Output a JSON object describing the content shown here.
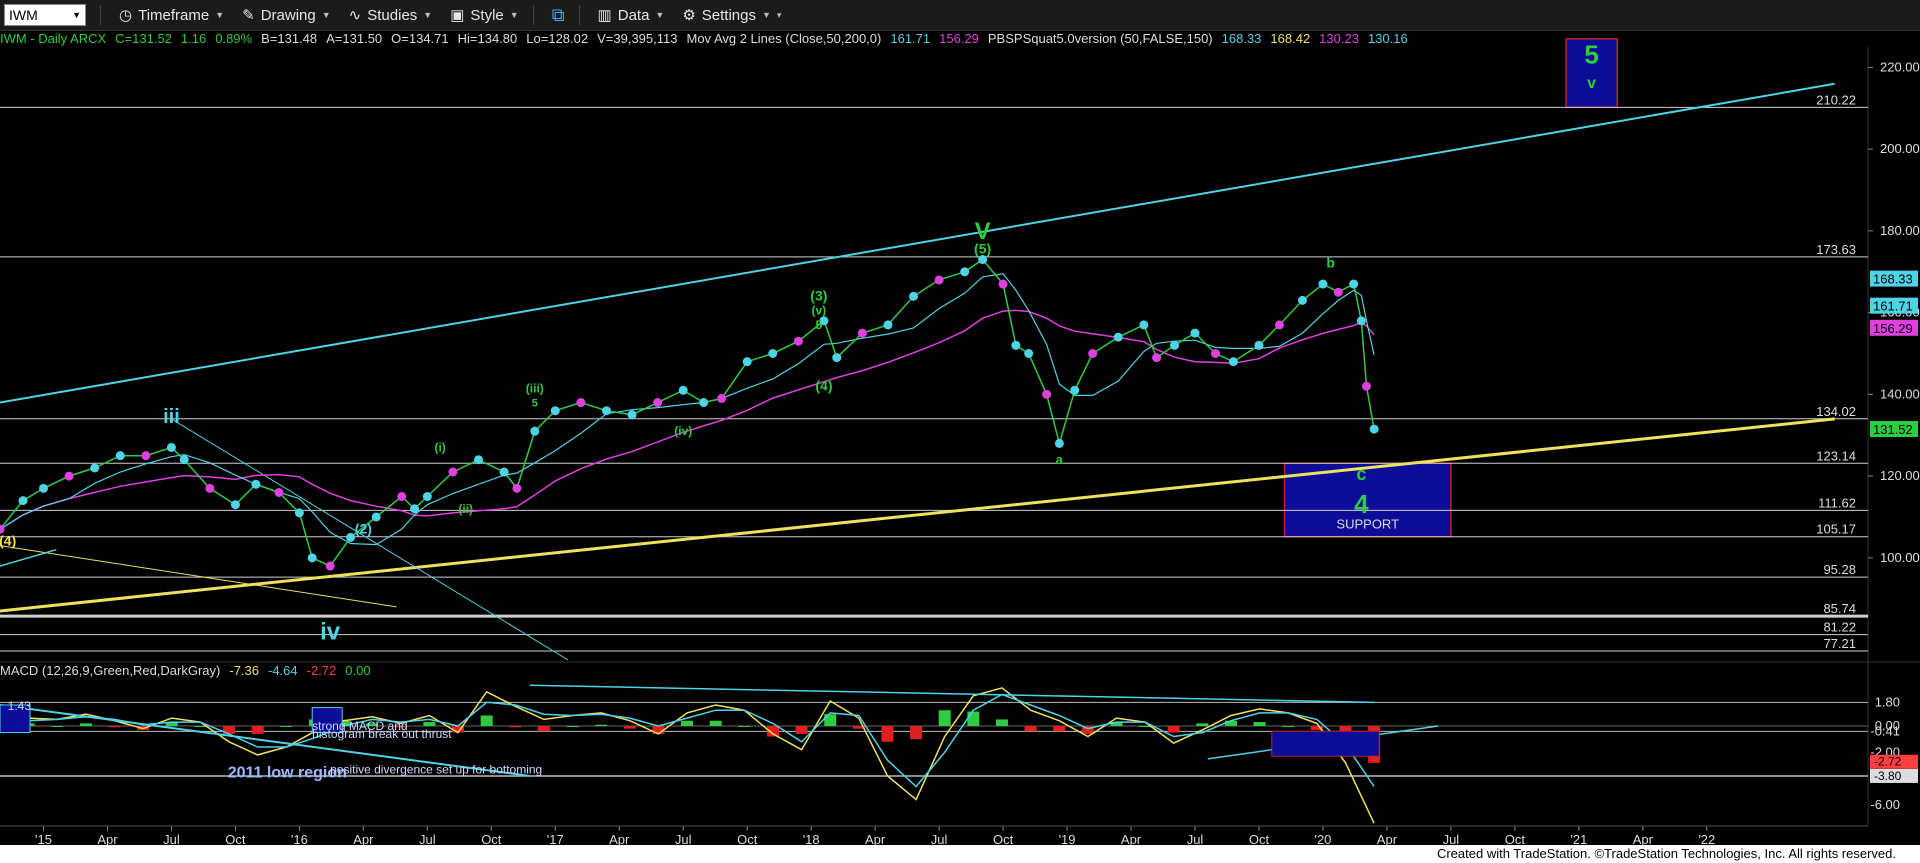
{
  "toolbar": {
    "symbol": "IWM",
    "items": [
      {
        "label": "Timeframe",
        "icon": "clock-icon"
      },
      {
        "label": "Drawing",
        "icon": "pencil-icon"
      },
      {
        "label": "Studies",
        "icon": "studies-icon"
      },
      {
        "label": "Style",
        "icon": "style-icon"
      },
      {
        "label": "",
        "icon": "layout-icon"
      },
      {
        "label": "Data",
        "icon": "data-icon"
      },
      {
        "label": "Settings",
        "icon": "gear-icon"
      }
    ]
  },
  "legend": [
    {
      "text": "IWM - Daily  ARCX",
      "color": "#2ecc40"
    },
    {
      "text": "C=131.52",
      "color": "#2ecc40"
    },
    {
      "text": "1.16",
      "color": "#2ecc40"
    },
    {
      "text": "0.89%",
      "color": "#2ecc40"
    },
    {
      "text": "B=131.48",
      "color": "#dddddd"
    },
    {
      "text": "A=131.50",
      "color": "#dddddd"
    },
    {
      "text": "O=134.71",
      "color": "#dddddd"
    },
    {
      "text": "Hi=134.80",
      "color": "#dddddd"
    },
    {
      "text": "Lo=128.02",
      "color": "#dddddd"
    },
    {
      "text": "V=39,395,113",
      "color": "#dddddd"
    },
    {
      "text": "Mov Avg 2 Lines (Close,50,200,0)",
      "color": "#dddddd"
    },
    {
      "text": "161.71",
      "color": "#4fd3e6"
    },
    {
      "text": "156.29",
      "color": "#e040e0"
    },
    {
      "text": "PBSPSquat5.0version (50,FALSE,150)",
      "color": "#dddddd"
    },
    {
      "text": "168.33",
      "color": "#4fd3e6"
    },
    {
      "text": "168.42",
      "color": "#f0e060"
    },
    {
      "text": "130.23",
      "color": "#e040e0"
    },
    {
      "text": "130.16",
      "color": "#4fd3e6"
    }
  ],
  "macd_legend": [
    {
      "text": "MACD (12,26,9,Green,Red,DarkGray)",
      "color": "#dddddd"
    },
    {
      "text": "-7.36",
      "color": "#f0e060"
    },
    {
      "text": "-4.64",
      "color": "#4fd3e6"
    },
    {
      "text": "-2.72",
      "color": "#ff4040"
    },
    {
      "text": "0.00",
      "color": "#2ecc40"
    }
  ],
  "footer": "Created with TradeStation. ©TradeStation Technologies, Inc. All rights reserved.",
  "chart_data": {
    "type": "line",
    "title": "IWM - Daily",
    "price_axis": {
      "ylim": [
        75,
        225
      ],
      "ticks": [
        100,
        120,
        140,
        160,
        180,
        200,
        220
      ]
    },
    "x_ticks": [
      "'15",
      "Apr",
      "Jul",
      "Oct",
      "'16",
      "Apr",
      "Jul",
      "Oct",
      "'17",
      "Apr",
      "Jul",
      "Oct",
      "'18",
      "Apr",
      "Jul",
      "Oct",
      "'19",
      "Apr",
      "Jul",
      "Oct",
      "'20",
      "Apr",
      "Jul",
      "Oct",
      "'21",
      "Apr",
      "'22"
    ],
    "price_series": {
      "name": "IWM",
      "color": "#2ecc40",
      "points": [
        [
          2014.83,
          107
        ],
        [
          2014.92,
          114
        ],
        [
          2015.0,
          117
        ],
        [
          2015.1,
          120
        ],
        [
          2015.2,
          122
        ],
        [
          2015.3,
          125
        ],
        [
          2015.4,
          125
        ],
        [
          2015.5,
          127
        ],
        [
          2015.55,
          124
        ],
        [
          2015.65,
          117
        ],
        [
          2015.75,
          113
        ],
        [
          2015.83,
          118
        ],
        [
          2015.92,
          116
        ],
        [
          2016.0,
          111
        ],
        [
          2016.05,
          100
        ],
        [
          2016.12,
          98
        ],
        [
          2016.2,
          105
        ],
        [
          2016.3,
          110
        ],
        [
          2016.4,
          115
        ],
        [
          2016.45,
          112
        ],
        [
          2016.5,
          115
        ],
        [
          2016.6,
          121
        ],
        [
          2016.7,
          124
        ],
        [
          2016.8,
          121
        ],
        [
          2016.85,
          117
        ],
        [
          2016.92,
          131
        ],
        [
          2017.0,
          136
        ],
        [
          2017.1,
          138
        ],
        [
          2017.2,
          136
        ],
        [
          2017.3,
          135
        ],
        [
          2017.4,
          138
        ],
        [
          2017.5,
          141
        ],
        [
          2017.58,
          138
        ],
        [
          2017.65,
          139
        ],
        [
          2017.75,
          148
        ],
        [
          2017.85,
          150
        ],
        [
          2017.95,
          153
        ],
        [
          2018.05,
          158
        ],
        [
          2018.1,
          149
        ],
        [
          2018.2,
          155
        ],
        [
          2018.3,
          157
        ],
        [
          2018.4,
          164
        ],
        [
          2018.5,
          168
        ],
        [
          2018.6,
          170
        ],
        [
          2018.67,
          173
        ],
        [
          2018.75,
          167
        ],
        [
          2018.8,
          152
        ],
        [
          2018.85,
          150
        ],
        [
          2018.92,
          140
        ],
        [
          2018.97,
          128
        ],
        [
          2019.03,
          141
        ],
        [
          2019.1,
          150
        ],
        [
          2019.2,
          154
        ],
        [
          2019.3,
          157
        ],
        [
          2019.35,
          149
        ],
        [
          2019.42,
          152
        ],
        [
          2019.5,
          155
        ],
        [
          2019.58,
          150
        ],
        [
          2019.65,
          148
        ],
        [
          2019.75,
          152
        ],
        [
          2019.83,
          157
        ],
        [
          2019.92,
          163
        ],
        [
          2020.0,
          167
        ],
        [
          2020.06,
          165
        ],
        [
          2020.12,
          167
        ],
        [
          2020.15,
          158
        ],
        [
          2020.17,
          142
        ],
        [
          2020.2,
          131.5
        ]
      ]
    },
    "moving_averages": [
      {
        "name": "Mov Avg 50",
        "value": 161.71,
        "color": "#4fd3e6"
      },
      {
        "name": "Mov Avg 200",
        "value": 156.29,
        "color": "#e040e0"
      }
    ],
    "horizontal_levels": [
      210.22,
      173.63,
      134.02,
      123.14,
      111.62,
      105.17,
      95.28,
      85.74,
      81.22,
      77.21
    ],
    "price_labels": [
      {
        "text": "168.33",
        "value": 168.33,
        "bg": "#4fd3e6",
        "fg": "#000000"
      },
      {
        "text": "161.71",
        "value": 161.71,
        "bg": "#4fd3e6",
        "fg": "#000000"
      },
      {
        "text": "156.29",
        "value": 156.29,
        "bg": "#e040e0",
        "fg": "#000000"
      },
      {
        "text": "131.52",
        "value": 131.52,
        "bg": "#2ecc40",
        "fg": "#000000"
      }
    ],
    "boxes": [
      {
        "label": "SUPPORT",
        "x0": 2019.85,
        "x1": 2020.5,
        "y0": 105.17,
        "y1": 123.14
      },
      {
        "label": "",
        "x0": 2020.95,
        "x1": 2021.15,
        "y0": 210.22,
        "y1": 227
      }
    ],
    "trendlines": [
      {
        "color": "#4fd3e6",
        "from": [
          2014.83,
          138
        ],
        "to": [
          2022.0,
          216
        ]
      },
      {
        "color": "#f0e060",
        "from": [
          2014.83,
          87
        ],
        "to": [
          2022.0,
          134
        ]
      }
    ],
    "wave_labels": [
      {
        "text": "5",
        "x": 2021.05,
        "y": 221,
        "size": 26,
        "color": "#2ecc40"
      },
      {
        "text": "v",
        "x": 2021.05,
        "y": 215,
        "size": 16,
        "color": "#2ecc40"
      },
      {
        "text": "V",
        "x": 2018.67,
        "y": 178,
        "size": 24,
        "color": "#2ecc40"
      },
      {
        "text": "(5)",
        "x": 2018.67,
        "y": 174.5,
        "size": 14,
        "color": "#2ecc40"
      },
      {
        "text": "(3)",
        "x": 2018.03,
        "y": 163,
        "size": 14,
        "color": "#2ecc40"
      },
      {
        "text": "(v)",
        "x": 2018.03,
        "y": 159.5,
        "size": 12,
        "color": "#2ecc40"
      },
      {
        "text": "5",
        "x": 2018.03,
        "y": 156,
        "size": 12,
        "color": "#2ecc40"
      },
      {
        "text": "(4)",
        "x": 2018.05,
        "y": 141,
        "size": 14,
        "color": "#2ecc40"
      },
      {
        "text": "b",
        "x": 2020.03,
        "y": 171,
        "size": 14,
        "color": "#2ecc40"
      },
      {
        "text": "a",
        "x": 2018.97,
        "y": 123,
        "size": 13,
        "color": "#2ecc40"
      },
      {
        "text": "c",
        "x": 2020.15,
        "y": 119,
        "size": 18,
        "color": "#2ecc40"
      },
      {
        "text": "4",
        "x": 2020.15,
        "y": 111,
        "size": 26,
        "color": "#2ecc40"
      },
      {
        "text": "(iii)",
        "x": 2016.92,
        "y": 140.5,
        "size": 12,
        "color": "#2ecc40"
      },
      {
        "text": "5",
        "x": 2016.92,
        "y": 137,
        "size": 11,
        "color": "#2ecc40"
      },
      {
        "text": "(iv)",
        "x": 2017.5,
        "y": 130,
        "size": 12,
        "color": "#2ecc40"
      },
      {
        "text": "(i)",
        "x": 2016.55,
        "y": 126,
        "size": 12,
        "color": "#2ecc40"
      },
      {
        "text": "(ii)",
        "x": 2016.65,
        "y": 111,
        "size": 12,
        "color": "#2ecc40"
      },
      {
        "text": "(2)",
        "x": 2016.25,
        "y": 106,
        "size": 14,
        "color": "#4fd3e6"
      },
      {
        "text": "iii",
        "x": 2015.5,
        "y": 133,
        "size": 20,
        "color": "#4fd3e6"
      },
      {
        "text": "iv",
        "x": 2016.12,
        "y": 80,
        "size": 24,
        "color": "#4fd3e6"
      },
      {
        "text": "(4)",
        "x": 2014.86,
        "y": 103,
        "size": 14,
        "color": "#f0e060"
      }
    ],
    "macd": {
      "ylim": [
        -7,
        3.5
      ],
      "ticks": [
        1.8,
        0.0,
        -0.41,
        -2.0,
        -4.0,
        -6.0
      ],
      "labels": [
        "1.80",
        "0.00",
        "-0.41",
        "-2.00",
        "-4.00",
        "-6.00"
      ],
      "highlighted": [
        {
          "text": "-2.72",
          "value": -2.72,
          "bg": "#ff4040"
        },
        {
          "text": "-3.80",
          "value": -3.8,
          "bg": "#dddddd"
        }
      ],
      "annotations": [
        {
          "text": "1.43",
          "x": 2014.86,
          "y": 1.2
        },
        {
          "text": "strong MACD and",
          "x": 2016.05,
          "y": -0.3
        },
        {
          "text": "histogram break out thrust",
          "x": 2016.05,
          "y": -0.9
        },
        {
          "text": "2011 low region",
          "x": 2015.72,
          "y": -3.9
        },
        {
          "text": "positive divergence set up for bottoming",
          "x": 2016.12,
          "y": -3.6
        }
      ],
      "series": [
        {
          "name": "MACD",
          "color": "#f0e060",
          "values": [
            0.2,
            0.6,
            0.5,
            0.9,
            0.4,
            -0.2,
            0.6,
            0.3,
            -1.2,
            -2.2,
            -1.6,
            -0.4,
            0.4,
            0.7,
            0.2,
            0.8,
            -0.5,
            2.6,
            1.5,
            0.5,
            0.8,
            1.0,
            0.4,
            -0.6,
            1.0,
            1.6,
            1.2,
            -0.6,
            -1.8,
            1.9,
            0.6,
            -3.8,
            -5.6,
            -0.8,
            2.3,
            2.9,
            1.2,
            0.4,
            -0.8,
            0.6,
            0.3,
            -1.3,
            -0.3,
            0.8,
            1.3,
            1.0,
            0.2,
            -2.8,
            -7.4
          ]
        },
        {
          "name": "Signal",
          "color": "#4fd3e6",
          "values": [
            0.1,
            0.4,
            0.5,
            0.7,
            0.5,
            0.1,
            0.3,
            0.3,
            -0.6,
            -1.6,
            -1.6,
            -0.9,
            0.0,
            0.5,
            0.3,
            0.5,
            0.0,
            1.8,
            1.6,
            0.9,
            0.8,
            0.9,
            0.6,
            0.0,
            0.6,
            1.2,
            1.2,
            0.2,
            -1.2,
            1.0,
            0.8,
            -2.6,
            -4.6,
            -2.0,
            1.2,
            2.4,
            1.6,
            0.8,
            -0.2,
            0.3,
            0.3,
            -0.8,
            -0.5,
            0.4,
            1.0,
            1.0,
            0.5,
            -1.4,
            -4.6
          ]
        }
      ]
    }
  }
}
